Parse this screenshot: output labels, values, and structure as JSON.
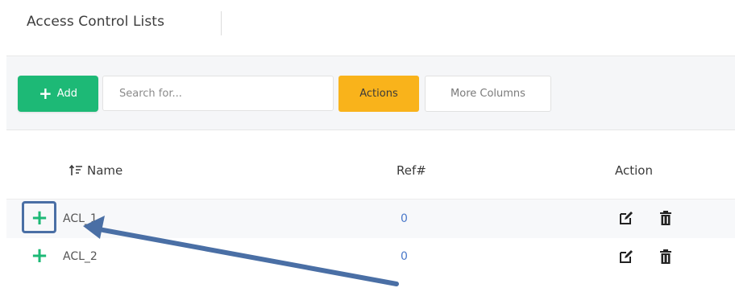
{
  "header": {
    "title": "Access Control Lists"
  },
  "toolbar": {
    "add_label": "Add",
    "search_placeholder": "Search for...",
    "actions_label": "Actions",
    "more_columns_label": "More Columns"
  },
  "table": {
    "columns": [
      "Name",
      "Ref#",
      "Action"
    ],
    "rows": [
      {
        "name": "ACL_1",
        "ref": "0"
      },
      {
        "name": "ACL_2",
        "ref": "0"
      }
    ]
  },
  "colors": {
    "accent_green": "#1db976",
    "actions_yellow": "#f9b31b",
    "link_blue": "#4a78c9",
    "annotation_arrow": "#4a6fa5"
  },
  "icons": {
    "add": "plus-icon",
    "sort": "sort-icon",
    "expand": "plus-icon",
    "edit": "edit-icon",
    "delete": "trash-icon"
  }
}
